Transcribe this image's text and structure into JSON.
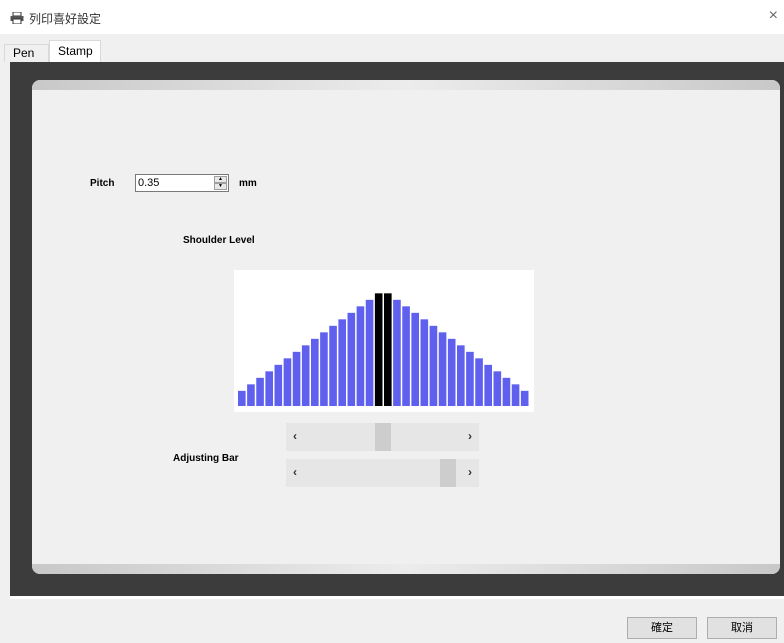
{
  "window": {
    "title": "列印喜好設定",
    "close_glyph": "×"
  },
  "tabs": [
    {
      "label": "Pen"
    },
    {
      "label": "Stamp"
    }
  ],
  "pitch": {
    "label": "Pitch",
    "value": "0.35",
    "unit": "mm"
  },
  "shoulder": {
    "label": "Shoulder Level"
  },
  "adjusting": {
    "label": "Adjusting Bar",
    "left_arrow": "‹",
    "right_arrow": "›",
    "bar1_position": 0.5,
    "bar2_position": 0.95
  },
  "buttons": {
    "ok": "確定",
    "cancel": "取消"
  },
  "chart_data": {
    "type": "bar",
    "values": [
      7,
      10,
      13,
      16,
      19,
      22,
      25,
      28,
      31,
      34,
      37,
      40,
      43,
      46,
      49,
      52,
      52,
      49,
      46,
      43,
      40,
      37,
      34,
      31,
      28,
      25,
      22,
      19,
      16,
      13,
      10,
      7
    ],
    "highlighted_indices": [
      15,
      16
    ],
    "colors": {
      "bar": "#6060ee",
      "highlight": "#000000"
    },
    "ylim": [
      0,
      60
    ]
  }
}
